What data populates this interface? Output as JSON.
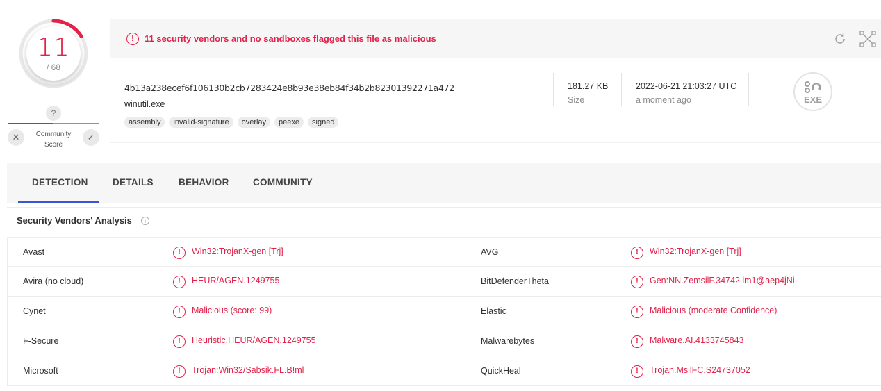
{
  "score": {
    "detections": "11",
    "total": "/ 68",
    "fraction": 0.1618,
    "color": "#e2224a"
  },
  "community": {
    "unknown": "?",
    "label": "Community Score",
    "label_line1": "Community",
    "label_line2": "Score",
    "negative": "✕",
    "positive": "✓"
  },
  "banner": {
    "text": "11 security vendors and no sandboxes flagged this file as malicious",
    "alert": "!"
  },
  "file": {
    "hash": "4b13a238ecef6f106130b2cb7283424e8b93e38eb84f34b2b82301392271a472",
    "name": "winutil.exe",
    "tags": [
      "assembly",
      "invalid-signature",
      "overlay",
      "peexe",
      "signed"
    ],
    "size_value": "181.27 KB",
    "size_label": "Size",
    "date_value": "2022-06-21 21:03:27 UTC",
    "date_label": "a moment ago",
    "type_icon": "EXE"
  },
  "tabs": [
    "DETECTION",
    "DETAILS",
    "BEHAVIOR",
    "COMMUNITY"
  ],
  "section": {
    "title": "Security Vendors' Analysis",
    "info": "i"
  },
  "vendors": [
    {
      "left_name": "Avast",
      "left_result": "Win32:TrojanX-gen [Trj]",
      "right_name": "AVG",
      "right_result": "Win32:TrojanX-gen [Trj]"
    },
    {
      "left_name": "Avira (no cloud)",
      "left_result": "HEUR/AGEN.1249755",
      "right_name": "BitDefenderTheta",
      "right_result": "Gen:NN.ZemsilF.34742.lm1@aep4jNi"
    },
    {
      "left_name": "Cynet",
      "left_result": "Malicious (score: 99)",
      "right_name": "Elastic",
      "right_result": "Malicious (moderate Confidence)"
    },
    {
      "left_name": "F-Secure",
      "left_result": "Heuristic.HEUR/AGEN.1249755",
      "right_name": "Malwarebytes",
      "right_result": "Malware.AI.4133745843"
    },
    {
      "left_name": "Microsoft",
      "left_result": "Trojan:Win32/Sabsik.FL.B!ml",
      "right_name": "QuickHeal",
      "right_result": "Trojan.MsilFC.S24737052"
    }
  ]
}
